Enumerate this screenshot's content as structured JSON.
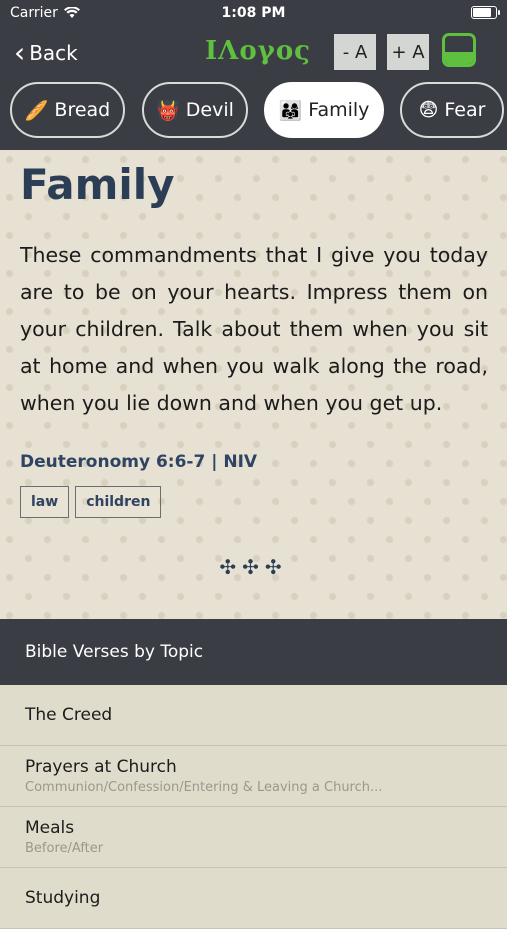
{
  "status": {
    "carrier": "Carrier",
    "time": "1:08 PM"
  },
  "nav": {
    "back_label": "Back",
    "logo": "ΙΛογος",
    "font_minus": "- A",
    "font_plus": "+ A"
  },
  "chips": [
    {
      "emoji": "🥖",
      "label": "Bread"
    },
    {
      "emoji": "👹",
      "label": "Devil"
    },
    {
      "emoji": "👨‍👩‍👧",
      "label": "Family"
    },
    {
      "emoji": "😨",
      "label": "Fear"
    }
  ],
  "verse": {
    "title": "Family",
    "text": "These commandments that I give you today are to be on your hearts. Impress them on your children. Talk about them when you sit at home and when you walk along the road, when you lie down and when you get up.",
    "reference": "Deuteronomy 6:6-7 | NIV",
    "tags": [
      "law",
      "children"
    ],
    "ornament": "✣✣✣"
  },
  "section": {
    "header": "Bible Verses by Topic"
  },
  "topics": [
    {
      "title": "The Creed",
      "subtitle": ""
    },
    {
      "title": "Prayers at Church",
      "subtitle": "Communion/Confession/Entering & Leaving a Church..."
    },
    {
      "title": "Meals",
      "subtitle": "Before/After"
    },
    {
      "title": "Studying",
      "subtitle": ""
    }
  ]
}
